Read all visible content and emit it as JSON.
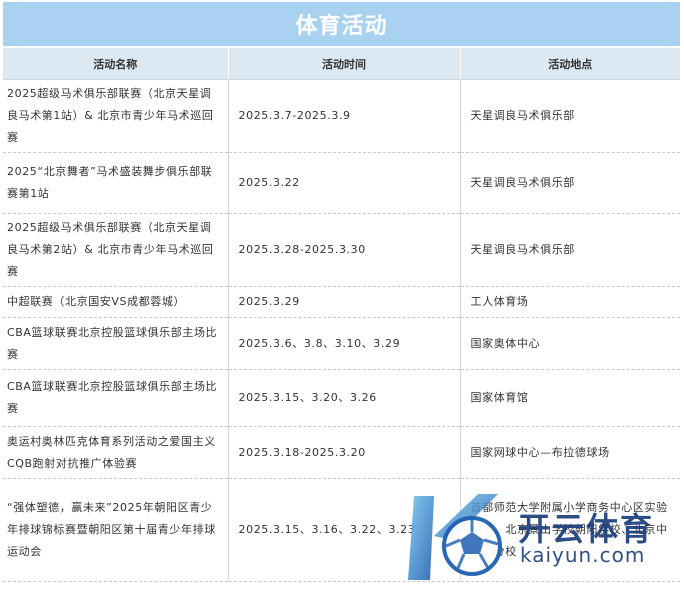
{
  "title": "体育活动",
  "table": {
    "headers": [
      "活动名称",
      "活动时间",
      "活动地点"
    ],
    "rows": [
      {
        "name": "2025超级马术俱乐部联赛（北京天星调良马术第1站）& 北京市青少年马术巡回赛",
        "time": "2025.3.7-2025.3.9",
        "place": "天星调良马术俱乐部"
      },
      {
        "name": "2025“北京舞者”马术盛装舞步俱乐部联赛第1站",
        "time": "2025.3.22",
        "place": "天星调良马术俱乐部"
      },
      {
        "name": "2025超级马术俱乐部联赛（北京天星调良马术第2站）& 北京市青少年马术巡回赛",
        "time": "2025.3.28-2025.3.30",
        "place": "天星调良马术俱乐部"
      },
      {
        "name": "中超联赛（北京国安VS成都蓉城）",
        "time": "2025.3.29",
        "place": "工人体育场"
      },
      {
        "name": "CBA篮球联赛北京控股篮球俱乐部主场比赛",
        "time": "2025.3.6、3.8、3.10、3.29",
        "place": "国家奥体中心"
      },
      {
        "name": "CBA篮球联赛北京控股篮球俱乐部主场比赛",
        "time": "2025.3.15、3.20、3.26",
        "place": "国家体育馆"
      },
      {
        "name": "奥运村奥林匹克体育系列活动之爱国主义CQB跑射对抗推广体验赛",
        "time": "2025.3.18-2025.3.20",
        "place": "国家网球中心—布拉德球场"
      },
      {
        "name": "“强体塑德，赢未来”2025年朝阳区青少年排球锦标赛暨朝阳区第十届青少年排球运动会",
        "time": "2025.3.15、3.16、3.22、3.23",
        "place": "首都师范大学附属小学商务中心区实验小学、北京景山学校朝阳学校、北京中学二分校"
      }
    ]
  },
  "watermark": {
    "cn": "开云体育",
    "en": "kaiyun.com",
    "logo_icon": "k-ball-logo-icon",
    "colors": {
      "blue": "#1a3d7a",
      "light": "#5fb3e8"
    }
  }
}
